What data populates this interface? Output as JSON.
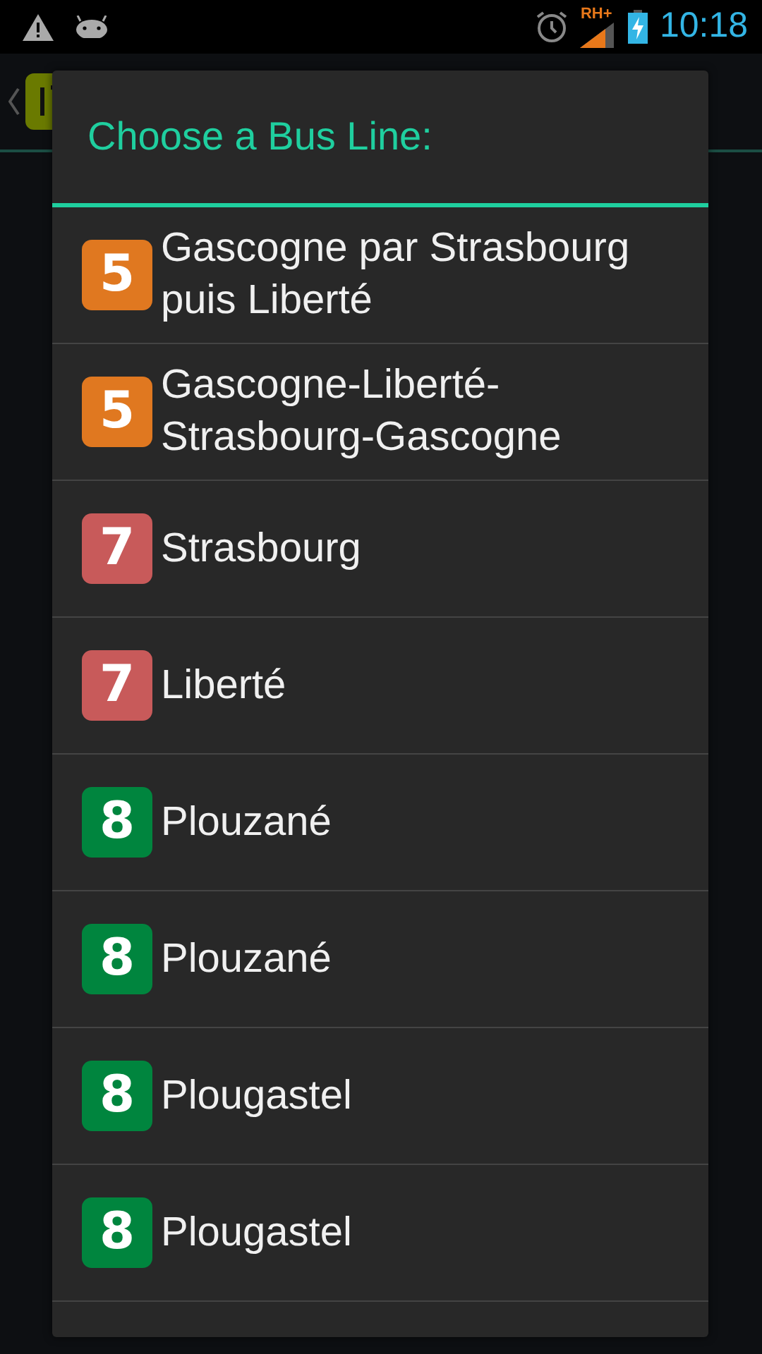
{
  "status_bar": {
    "network": "RH+",
    "time": "10:18"
  },
  "dialog": {
    "title": "Choose a Bus Line:",
    "lines": [
      {
        "number": "5",
        "color": "#e07820",
        "name": "Gascogne par Strasbourg puis Liberté"
      },
      {
        "number": "5",
        "color": "#e07820",
        "name": "Gascogne-Liberté-Strasbourg-Gascogne"
      },
      {
        "number": "7",
        "color": "#c85a5a",
        "name": "Strasbourg"
      },
      {
        "number": "7",
        "color": "#c85a5a",
        "name": "Liberté"
      },
      {
        "number": "8",
        "color": "#00853e",
        "name": "Plouzané"
      },
      {
        "number": "8",
        "color": "#00853e",
        "name": "Plouzané"
      },
      {
        "number": "8",
        "color": "#00853e",
        "name": "Plougastel"
      },
      {
        "number": "8",
        "color": "#00853e",
        "name": "Plougastel"
      }
    ]
  }
}
